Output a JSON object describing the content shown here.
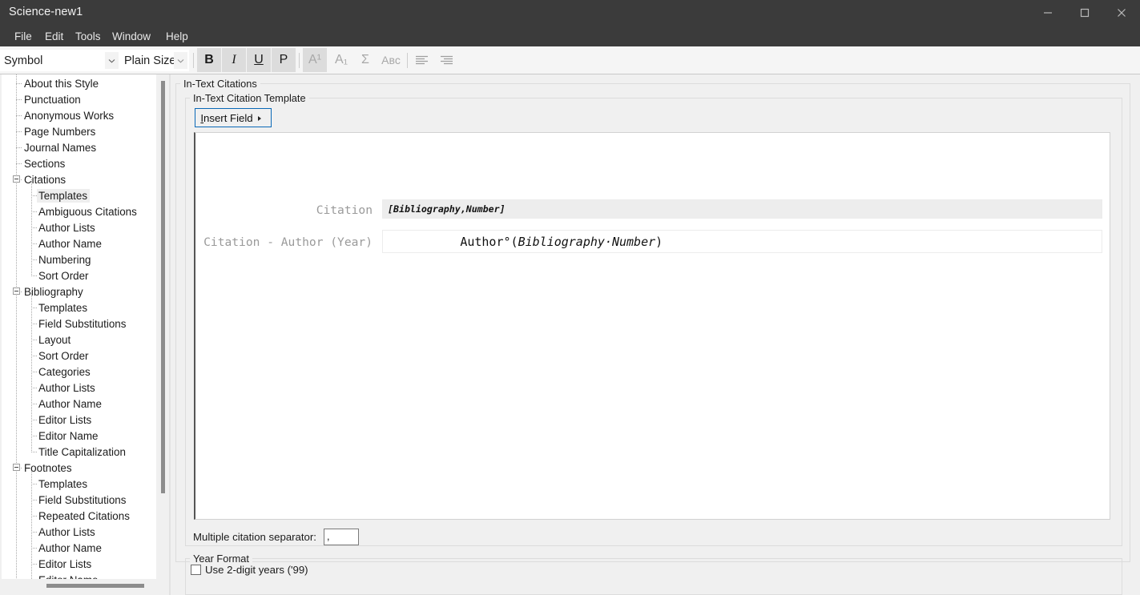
{
  "window": {
    "title": "Science-new1",
    "controls": [
      {
        "name": "minimize",
        "glyph": "minimize-icon"
      },
      {
        "name": "maximize",
        "glyph": "maximize-icon"
      },
      {
        "name": "close",
        "glyph": "close-icon"
      }
    ]
  },
  "menubar": {
    "items": [
      {
        "label": "File"
      },
      {
        "label": "Edit"
      },
      {
        "label": "Tools"
      },
      {
        "label": "Window"
      },
      {
        "label": "Help"
      }
    ]
  },
  "toolbar": {
    "font_combo": {
      "value": "Symbol",
      "arrow": "chevron-down-icon"
    },
    "size_combo": {
      "value": "Plain Size",
      "arrow": "chevron-down-icon"
    },
    "buttons": [
      {
        "name": "bold",
        "label": "B",
        "active": true
      },
      {
        "name": "italic",
        "label": "I",
        "active": true
      },
      {
        "name": "underline",
        "label": "U",
        "active": true
      },
      {
        "name": "plain",
        "label": "P",
        "active": true
      },
      {
        "name": "superscript",
        "label": "A¹",
        "active": true
      },
      {
        "name": "subscript",
        "label": "A₁",
        "active": false
      },
      {
        "name": "symbol",
        "label": "Σ",
        "active": false
      },
      {
        "name": "small-caps",
        "label": "Aʙᴄ",
        "active": false
      },
      {
        "name": "align-left",
        "label": "align-left-icon",
        "active": false
      },
      {
        "name": "align-right",
        "label": "align-right-icon",
        "active": false
      }
    ]
  },
  "tree": {
    "nodes": [
      {
        "label": "About this Style",
        "depth": 1,
        "expander": false,
        "selected": false
      },
      {
        "label": "Punctuation",
        "depth": 1,
        "expander": false,
        "selected": false
      },
      {
        "label": "Anonymous Works",
        "depth": 1,
        "expander": false,
        "selected": false
      },
      {
        "label": "Page Numbers",
        "depth": 1,
        "expander": false,
        "selected": false
      },
      {
        "label": "Journal Names",
        "depth": 1,
        "expander": false,
        "selected": false
      },
      {
        "label": "Sections",
        "depth": 1,
        "expander": false,
        "selected": false
      },
      {
        "label": "Citations",
        "depth": 1,
        "expander": true,
        "selected": false
      },
      {
        "label": "Templates",
        "depth": 2,
        "expander": false,
        "selected": true
      },
      {
        "label": "Ambiguous Citations",
        "depth": 2,
        "expander": false,
        "selected": false
      },
      {
        "label": "Author Lists",
        "depth": 2,
        "expander": false,
        "selected": false
      },
      {
        "label": "Author Name",
        "depth": 2,
        "expander": false,
        "selected": false
      },
      {
        "label": "Numbering",
        "depth": 2,
        "expander": false,
        "selected": false
      },
      {
        "label": "Sort Order",
        "depth": 2,
        "expander": false,
        "selected": false
      },
      {
        "label": "Bibliography",
        "depth": 1,
        "expander": true,
        "selected": false
      },
      {
        "label": "Templates",
        "depth": 2,
        "expander": false,
        "selected": false
      },
      {
        "label": "Field Substitutions",
        "depth": 2,
        "expander": false,
        "selected": false
      },
      {
        "label": "Layout",
        "depth": 2,
        "expander": false,
        "selected": false
      },
      {
        "label": "Sort Order",
        "depth": 2,
        "expander": false,
        "selected": false
      },
      {
        "label": "Categories",
        "depth": 2,
        "expander": false,
        "selected": false
      },
      {
        "label": "Author Lists",
        "depth": 2,
        "expander": false,
        "selected": false
      },
      {
        "label": "Author Name",
        "depth": 2,
        "expander": false,
        "selected": false
      },
      {
        "label": "Editor Lists",
        "depth": 2,
        "expander": false,
        "selected": false
      },
      {
        "label": "Editor Name",
        "depth": 2,
        "expander": false,
        "selected": false
      },
      {
        "label": "Title Capitalization",
        "depth": 2,
        "expander": false,
        "selected": false
      },
      {
        "label": "Footnotes",
        "depth": 1,
        "expander": true,
        "selected": false
      },
      {
        "label": "Templates",
        "depth": 2,
        "expander": false,
        "selected": false
      },
      {
        "label": "Field Substitutions",
        "depth": 2,
        "expander": false,
        "selected": false
      },
      {
        "label": "Repeated Citations",
        "depth": 2,
        "expander": false,
        "selected": false
      },
      {
        "label": "Author Lists",
        "depth": 2,
        "expander": false,
        "selected": false
      },
      {
        "label": "Author Name",
        "depth": 2,
        "expander": false,
        "selected": false
      },
      {
        "label": "Editor Lists",
        "depth": 2,
        "expander": false,
        "selected": false
      },
      {
        "label": "Editor Name",
        "depth": 2,
        "expander": false,
        "selected": false
      }
    ]
  },
  "main": {
    "group_intext_label": "In-Text Citations",
    "group_template_label": "In-Text Citation Template",
    "insert_field_button": {
      "accel": "I",
      "rest": "nsert Field"
    },
    "rows": [
      {
        "label": "Citation",
        "value": "[Bibliography,Number]"
      },
      {
        "label": "Citation - Author (Year)",
        "value_plain": "Author°(",
        "value_italic": "Bibliography·Number",
        "value_tail": ")"
      }
    ],
    "separator_label": "Multiple citation separator:",
    "separator_value": ",",
    "group_year_label": "Year Format",
    "two_digit_years_label": "Use 2-digit years ('99)",
    "two_digit_years_checked": false
  }
}
